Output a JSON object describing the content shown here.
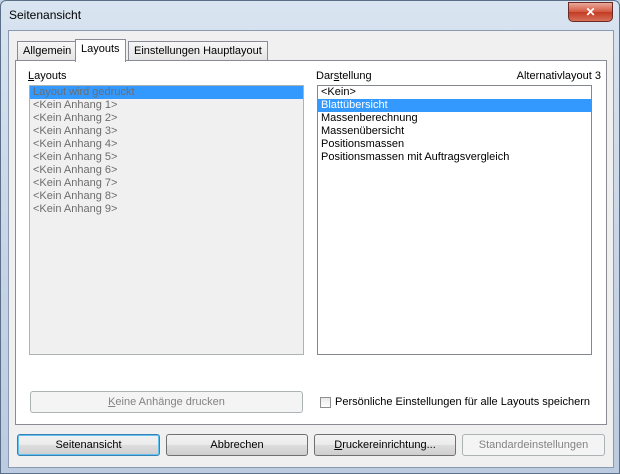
{
  "window": {
    "title": "Seitenansicht",
    "close_icon": "close-icon",
    "close_glyph": "✕"
  },
  "tabs": [
    {
      "label": "Allgemein",
      "active": false
    },
    {
      "label": "Layouts",
      "active": true
    },
    {
      "label": "Einstellungen Hauptlayout",
      "active": false
    }
  ],
  "layouts": {
    "label_first": "L",
    "label_rest": "ayouts",
    "items": [
      {
        "label": "Layout wird gedruckt",
        "selected": true
      },
      {
        "label": "<Kein Anhang 1>",
        "selected": false
      },
      {
        "label": "<Kein Anhang 2>",
        "selected": false
      },
      {
        "label": "<Kein Anhang 3>",
        "selected": false
      },
      {
        "label": "<Kein Anhang 4>",
        "selected": false
      },
      {
        "label": "<Kein Anhang 5>",
        "selected": false
      },
      {
        "label": "<Kein Anhang 6>",
        "selected": false
      },
      {
        "label": "<Kein Anhang 7>",
        "selected": false
      },
      {
        "label": "<Kein Anhang 8>",
        "selected": false
      },
      {
        "label": "<Kein Anhang 9>",
        "selected": false
      }
    ]
  },
  "darstellung": {
    "label_pre": "Dar",
    "label_u": "s",
    "label_post": "tellung",
    "alt_label": "Alternativlayout 3",
    "items": [
      {
        "label": "<Kein>",
        "selected": false
      },
      {
        "label": "Blattübersicht",
        "selected": true
      },
      {
        "label": "Massenberechnung",
        "selected": false
      },
      {
        "label": "Massenübersicht",
        "selected": false
      },
      {
        "label": "Positionsmassen",
        "selected": false
      },
      {
        "label": "Positionsmassen mit Auftragsvergleich",
        "selected": false
      }
    ]
  },
  "keine_anhaenge_button": {
    "label_u": "K",
    "label_rest": "eine Anhänge drucken",
    "enabled": false
  },
  "persoenlich_checkbox": {
    "label": "Persönliche Einstellungen für alle Layouts speichern",
    "checked": false
  },
  "footer": {
    "seitenansicht": "Seitenansicht",
    "abbrechen": "Abbrechen",
    "drucker_u": "D",
    "drucker_rest": "ruckereinrichtung...",
    "standard": "Standardeinstellungen"
  }
}
